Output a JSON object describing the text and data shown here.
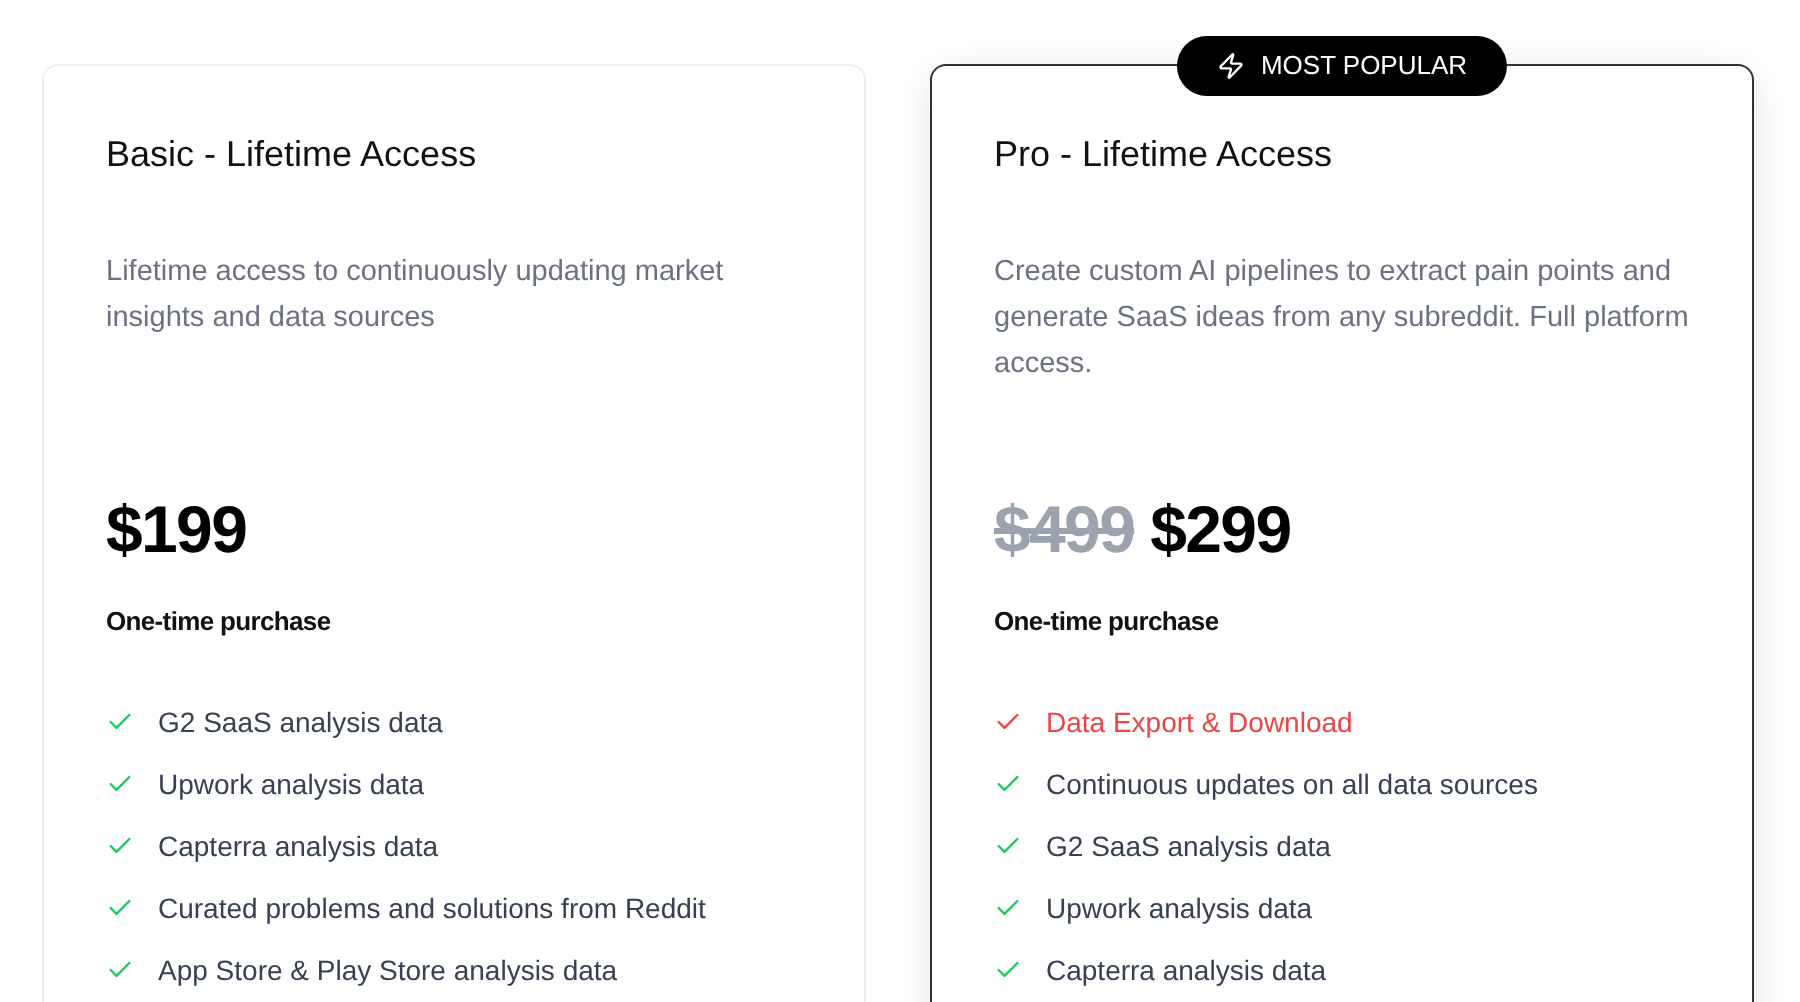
{
  "plans": [
    {
      "title": "Basic - Lifetime Access",
      "featured": false,
      "description": "Lifetime access to continuously updating market insights and data sources",
      "price": "$199",
      "price_note": "One-time purchase",
      "features": [
        {
          "label": "G2 SaaS analysis data",
          "kind": "normal"
        },
        {
          "label": "Upwork analysis data",
          "kind": "normal"
        },
        {
          "label": "Capterra analysis data",
          "kind": "normal"
        },
        {
          "label": "Curated problems and solutions from Reddit",
          "kind": "normal"
        },
        {
          "label": "App Store & Play Store analysis data",
          "kind": "normal"
        }
      ]
    },
    {
      "title": "Pro - Lifetime Access",
      "badge": "MOST POPULAR",
      "featured": true,
      "description": "Create custom AI pipelines to extract pain points and generate SaaS ideas from any subreddit. Full platform access.",
      "old_price": "$499",
      "price": "$299",
      "price_note": "One-time purchase",
      "features": [
        {
          "label": "Data Export & Download",
          "kind": "highlight"
        },
        {
          "label": "Continuous updates on all data sources",
          "kind": "normal"
        },
        {
          "label": "G2 SaaS analysis data",
          "kind": "normal"
        },
        {
          "label": "Upwork analysis data",
          "kind": "normal"
        },
        {
          "label": "Capterra analysis data",
          "kind": "normal"
        }
      ]
    }
  ]
}
